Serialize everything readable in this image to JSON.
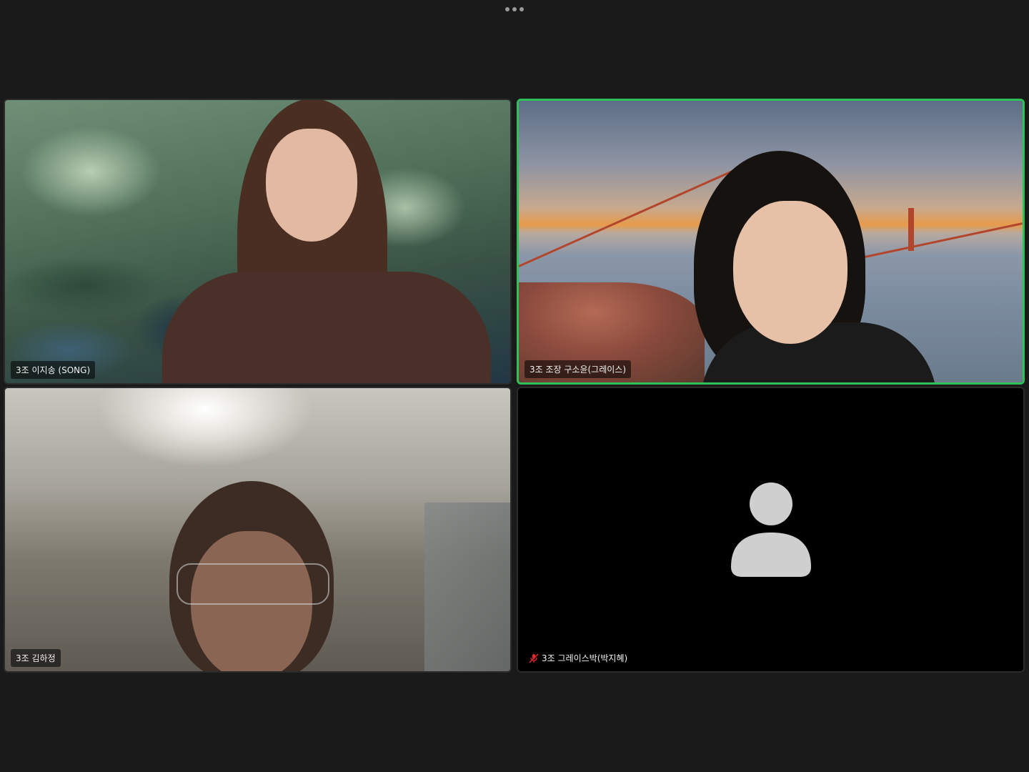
{
  "participants": [
    {
      "name": "3조 이지송 (SONG)",
      "muted": false,
      "active_speaker": false,
      "video": "on"
    },
    {
      "name": "3조 조장 구소윤(그레이스)",
      "muted": false,
      "active_speaker": true,
      "video": "on"
    },
    {
      "name": "3조 김하정",
      "muted": false,
      "active_speaker": false,
      "video": "on"
    },
    {
      "name": "3조 그레이스박(박지혜)",
      "muted": true,
      "active_speaker": false,
      "video": "off"
    }
  ],
  "colors": {
    "background": "#1a1a1a",
    "active_speaker_border": "#2fc25b",
    "muted_icon": "#e02828"
  },
  "icons": {
    "more_options": "more-horizontal-icon",
    "muted": "microphone-muted-icon",
    "avatar": "user-avatar-icon"
  }
}
